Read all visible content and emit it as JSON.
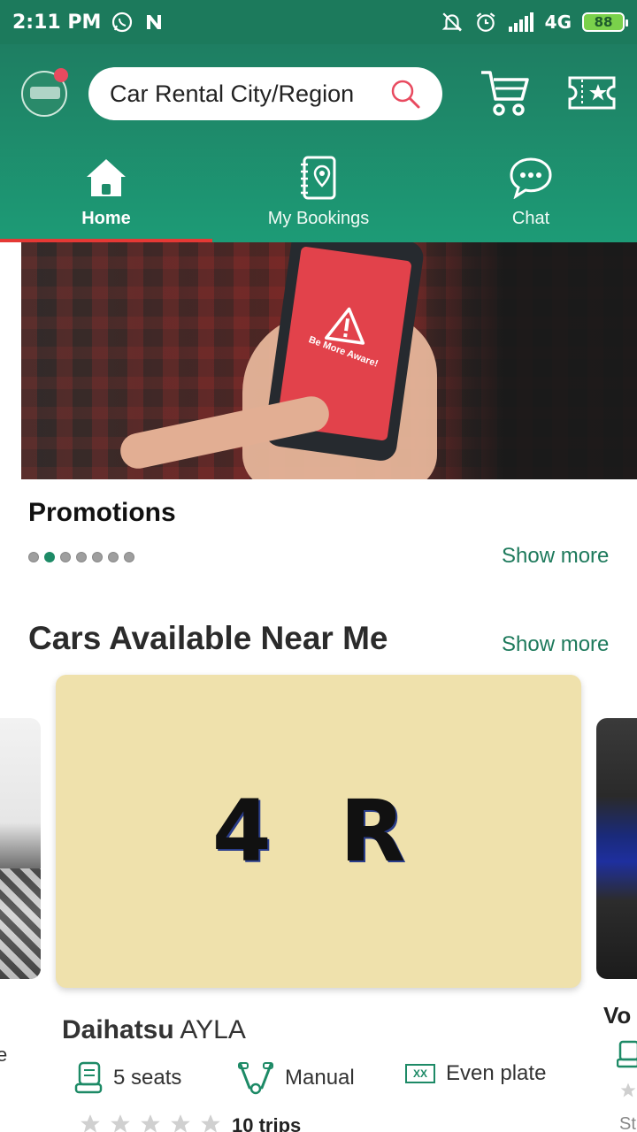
{
  "status_bar": {
    "time": "2:11 PM",
    "network": "4G",
    "battery": "88"
  },
  "header": {
    "search_placeholder": "Car Rental City/Region",
    "tabs": [
      {
        "label": "Home",
        "icon": "home-icon",
        "active": true
      },
      {
        "label": "My Bookings",
        "icon": "bookings-icon",
        "active": false
      },
      {
        "label": "Chat",
        "icon": "chat-icon",
        "active": false
      }
    ]
  },
  "banner": {
    "screen_text": "Be More Aware!"
  },
  "promotions": {
    "title": "Promotions",
    "show_more": "Show more",
    "dot_count": 7,
    "active_dot": 2
  },
  "cars": {
    "title": "Cars Available Near Me",
    "show_more": "Show more",
    "featured": {
      "plate": "4 R",
      "make": "Daihatsu",
      "model": "AYLA",
      "seats": "5 seats",
      "transmission": "Manual",
      "plate_rule_badge": "XX",
      "plate_rule": "Even plate",
      "rating_stars": 0,
      "trips": "10 trips"
    },
    "next_peek": "Vo",
    "next_peek_sub": "St"
  },
  "colors": {
    "brand_green": "#1d8a66",
    "active_tab_indicator": "#e53935",
    "notification_dot": "#e84a5f"
  }
}
